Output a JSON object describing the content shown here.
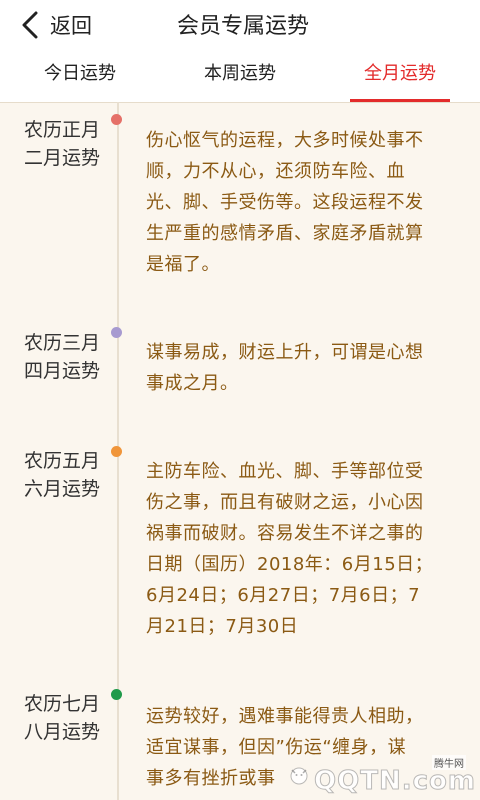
{
  "header": {
    "back_label": "返回",
    "title": "会员专属运势"
  },
  "tabs": [
    {
      "label": "今日运势",
      "active": false
    },
    {
      "label": "本周运势",
      "active": false
    },
    {
      "label": "全月运势",
      "active": true
    }
  ],
  "accent_color": "#e32b2b",
  "timeline": [
    {
      "month_line1": "农历正月",
      "month_line2": "二月运势",
      "dot_color": "#e57068",
      "text_lines": [
        "伤心怄气的运程，大多时候处事不",
        "顺，力不从心，还须防车险、血",
        "光、脚、手受伤等。这段运程不发",
        "生严重的感情矛盾、家庭矛盾就算",
        "是福了。"
      ]
    },
    {
      "month_line1": "农历三月",
      "month_line2": "四月运势",
      "dot_color": "#a79ad0",
      "text_lines": [
        "谋事易成，财运上升，可谓是心想",
        "事成之月。"
      ]
    },
    {
      "month_line1": "农历五月",
      "month_line2": "六月运势",
      "dot_color": "#f0953a",
      "text_lines": [
        "主防车险、血光、脚、手等部位受",
        "伤之事，而且有破财之运，小心因",
        "祸事而破财。容易发生不详之事的",
        "日期（国历）2018年：6月15日；",
        "6月24日；6月27日；7月6日；7",
        "月21日；7月30日"
      ]
    },
    {
      "month_line1": "农历七月",
      "month_line2": "八月运势",
      "dot_color": "#1f9a4a",
      "text_lines": [
        "运势较好，遇难事能得贵人相助，",
        "适宜谋事，但因”伤运“缠身，谋",
        "事多有挫折或事"
      ]
    }
  ],
  "watermark": {
    "small_text": "腾牛网",
    "logo_text": "QQTN.com"
  }
}
